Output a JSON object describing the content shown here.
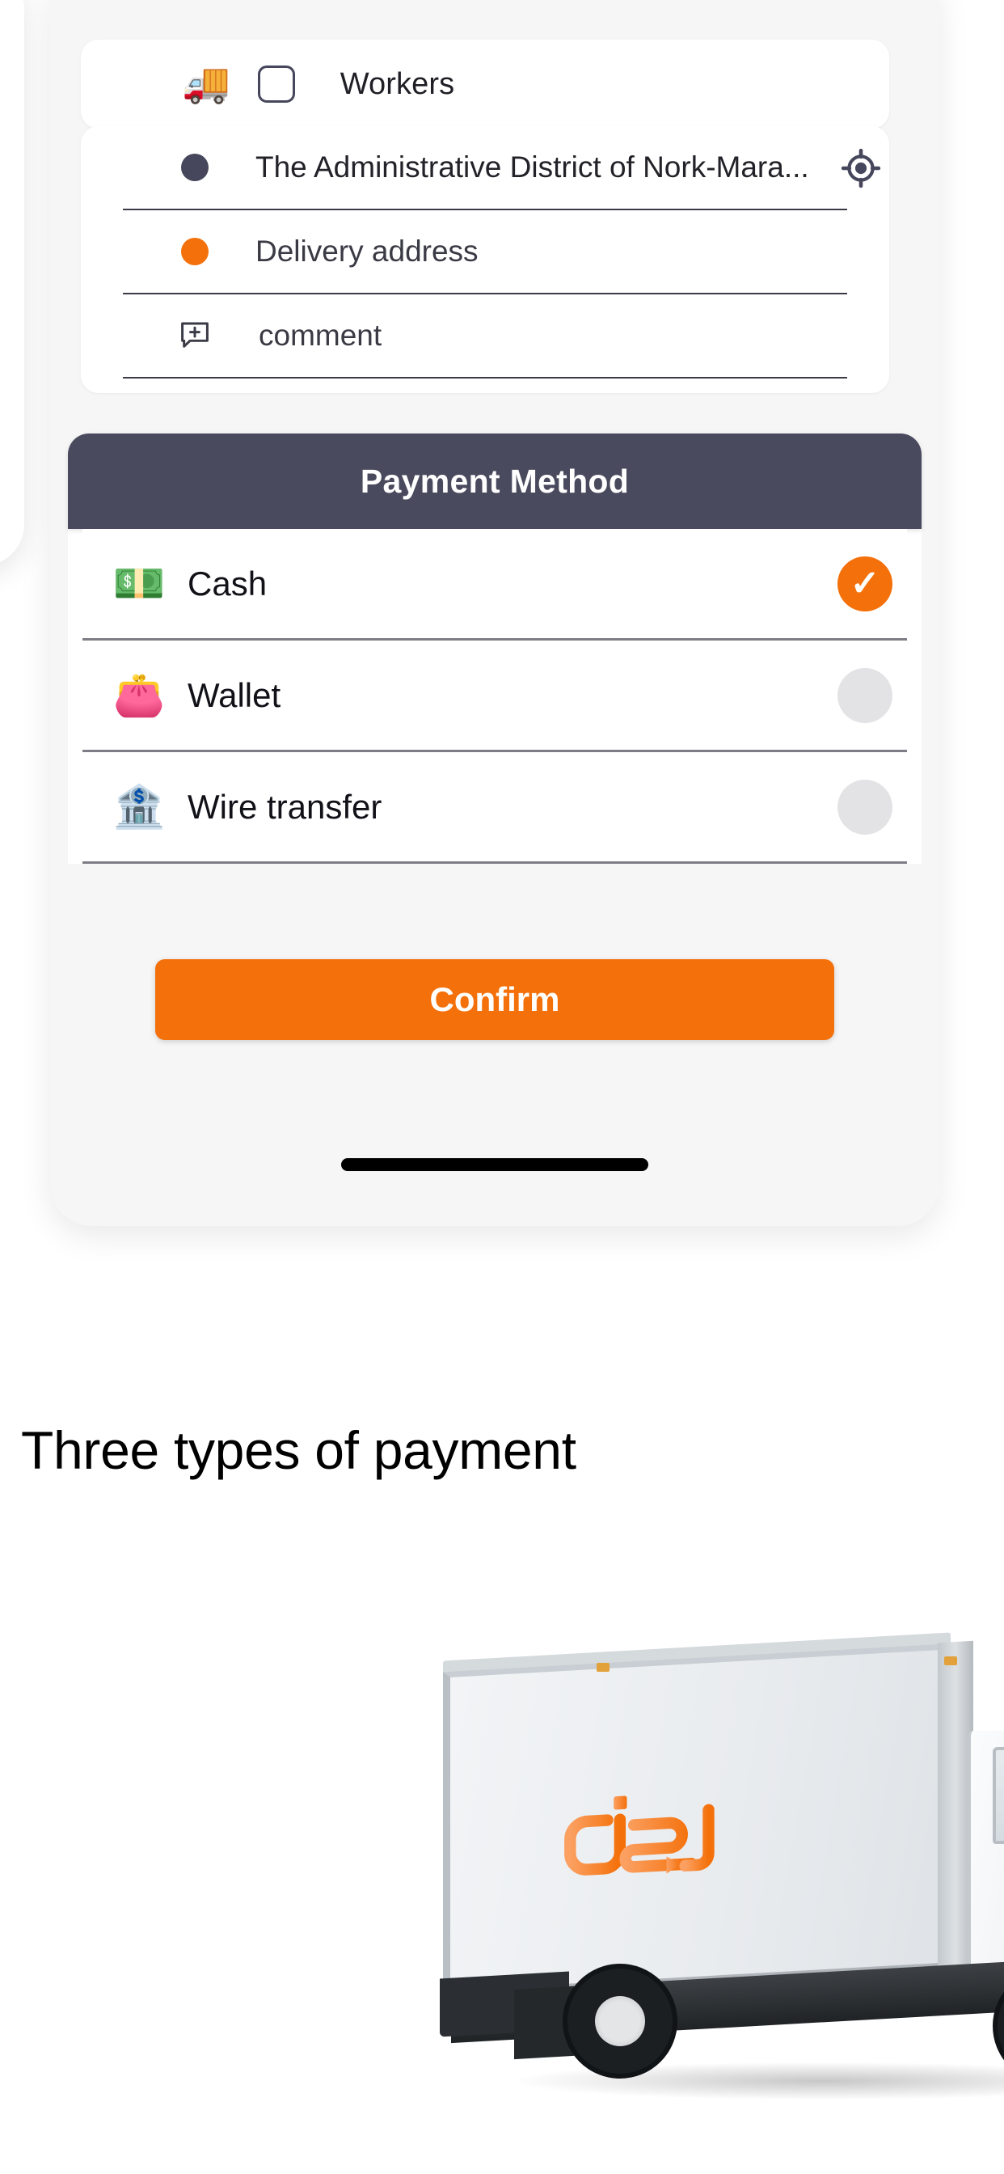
{
  "phone_screen": {
    "workers_row": {
      "truck_icon": "delivery-truck-emoji",
      "truck_glyph": "🚚",
      "checkbox_checked": false,
      "label": "Workers"
    },
    "address_form": {
      "pickup": {
        "marker_color": "#46465c",
        "value": "The Administrative District of Nork-Mara...",
        "action_icon": "gps-locate-icon"
      },
      "delivery": {
        "marker_color": "#f4700a",
        "placeholder": "Delivery address",
        "value": "Delivery address"
      },
      "comment": {
        "icon": "add-comment-icon",
        "placeholder": "comment",
        "value": "comment"
      }
    },
    "payment": {
      "header": "Payment Method",
      "header_bg": "#4a4a5e",
      "selected_method": "Cash",
      "methods": [
        {
          "label": "Cash",
          "emoji": "💵",
          "icon": "banknotes-icon",
          "selected": true
        },
        {
          "label": "Wallet",
          "emoji": "👛",
          "icon": "wallet-icon",
          "selected": false
        },
        {
          "label": "Wire transfer",
          "emoji": "🏦",
          "icon": "bank-icon",
          "selected": false
        }
      ],
      "check_glyph": "✓"
    },
    "confirm_button": {
      "label": "Confirm",
      "color": "#f4700a"
    }
  },
  "caption": {
    "text": "Three types of payment"
  },
  "truck_photo": {
    "logo_text": "c2d",
    "logo_color": "#f4813a"
  }
}
